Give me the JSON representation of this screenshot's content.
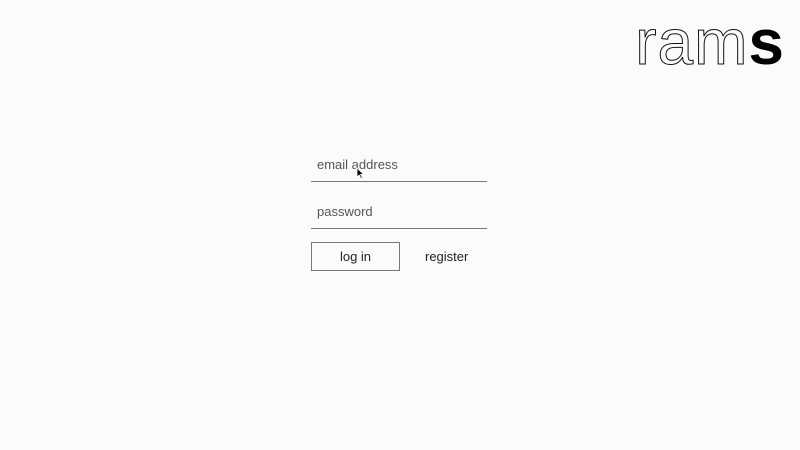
{
  "logo": {
    "outline_text": "ram",
    "solid_text": "s"
  },
  "login": {
    "email_placeholder": "email address",
    "email_value": "",
    "password_placeholder": "password",
    "password_value": "",
    "login_label": "log in",
    "register_label": "register"
  },
  "icons": {
    "cursor": "mouse-pointer-icon"
  },
  "colors": {
    "background": "#fcfbfc",
    "text": "#222222",
    "border": "#777777",
    "logo": "#000000"
  }
}
